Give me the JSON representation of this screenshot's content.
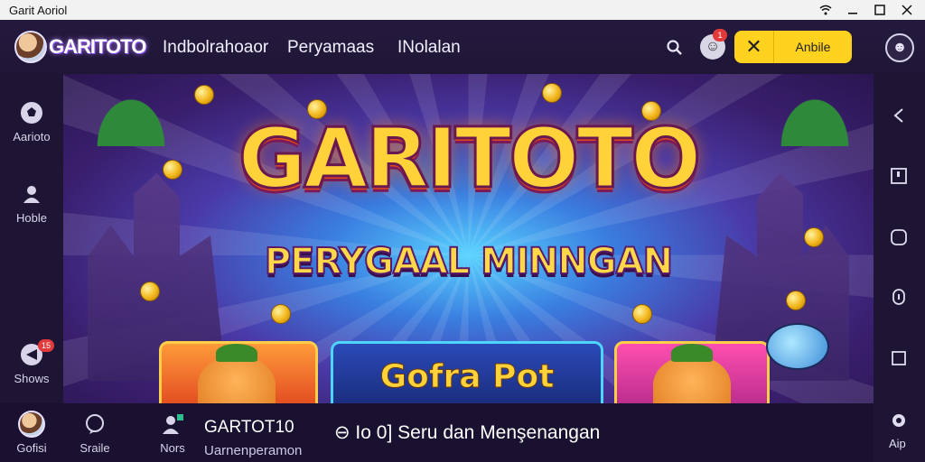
{
  "window": {
    "title": "Garit Aoriol"
  },
  "header": {
    "logo_text": "GARITOTO",
    "nav": [
      "Indbolrahoaor",
      "Peryamaas",
      "INolalan"
    ],
    "notification_count": "1",
    "pill_close": "✕",
    "pill_label": "Anbile"
  },
  "sidebar": {
    "items": [
      {
        "label": "Aarioto",
        "icon": "soccer-ball-icon"
      },
      {
        "label": "Hoble",
        "icon": "user-icon"
      },
      {
        "label": "Shows",
        "icon": "megaphone-icon",
        "badge": "15"
      }
    ]
  },
  "banner": {
    "headline": "GARITOTO",
    "subline": "PERYGAAL MINNGAN",
    "card_center_title": "Gofra Pot"
  },
  "right_rail": {
    "icons": [
      "back-icon",
      "square-outline-icon",
      "rounded-square-icon",
      "lock-icon",
      "square-icon"
    ],
    "bottom_label": "Aip"
  },
  "bottom": {
    "items": [
      {
        "label": "Gofisi",
        "icon": "avatar"
      },
      {
        "label": "Sraile",
        "icon": "chat-icon"
      },
      {
        "label": "Nors",
        "icon": "user-badge-icon"
      }
    ],
    "game_name": "GARTOT10",
    "game_sub": "Uarnenperamon",
    "marquee": "⊖ Io 0] Seru dan Menşenangan"
  },
  "colors": {
    "accent": "#ffd21f",
    "bg": "#1a1130",
    "badge": "#e23a3a"
  }
}
